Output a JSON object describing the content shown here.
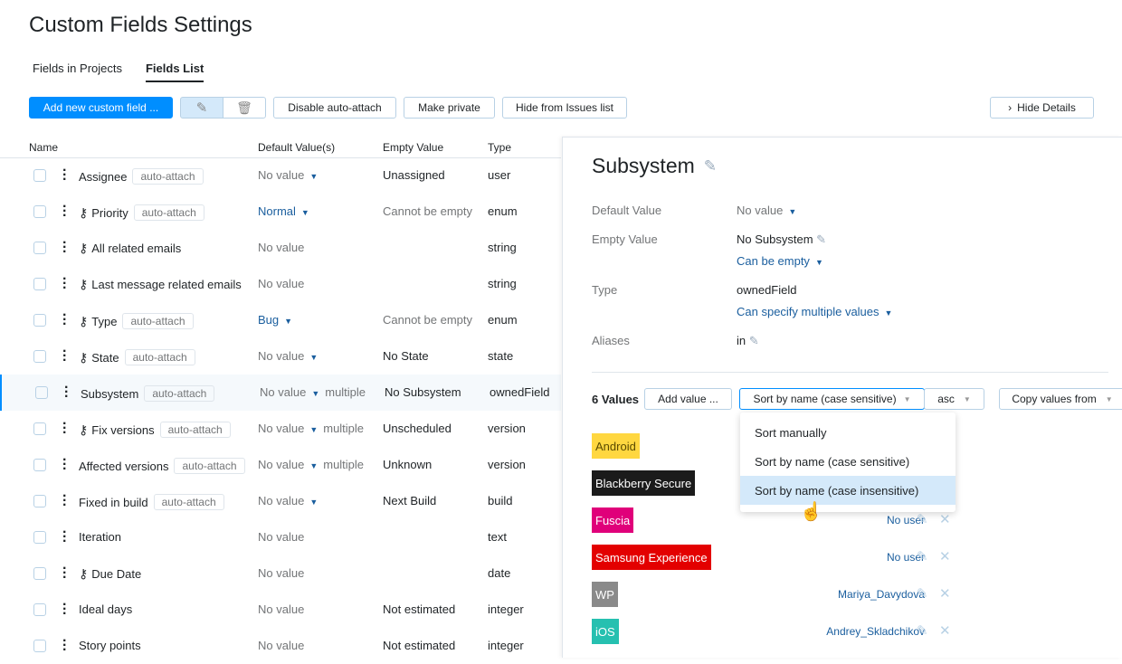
{
  "title": "Custom Fields Settings",
  "tabs": [
    {
      "label": "Fields in Projects"
    },
    {
      "label": "Fields List"
    }
  ],
  "toolbar": {
    "add": "Add new custom field ...",
    "disable": "Disable auto-attach",
    "private": "Make private",
    "hide_issues": "Hide from Issues list",
    "hide_details": "Hide Details"
  },
  "columns": {
    "name": "Name",
    "default": "Default Value(s)",
    "empty": "Empty Value",
    "type": "Type"
  },
  "rows": [
    {
      "name": "Assignee",
      "tag": "auto-attach",
      "key": false,
      "default": "No value",
      "dd": true,
      "multiple": "",
      "empty": "Unassigned",
      "type": "user"
    },
    {
      "name": "Priority",
      "tag": "auto-attach",
      "key": true,
      "default": "Normal",
      "dd": true,
      "link": true,
      "multiple": "",
      "empty": "Cannot be empty",
      "emptyMuted": true,
      "type": "enum"
    },
    {
      "name": "All related emails",
      "tag": "",
      "key": true,
      "default": "No value",
      "dd": false,
      "multiple": "",
      "empty": "",
      "type": "string"
    },
    {
      "name": "Last message related emails",
      "tag": "",
      "key": true,
      "default": "No value",
      "dd": false,
      "multiple": "",
      "empty": "",
      "type": "string"
    },
    {
      "name": "Type",
      "tag": "auto-attach",
      "key": true,
      "default": "Bug",
      "dd": true,
      "link": true,
      "multiple": "",
      "empty": "Cannot be empty",
      "emptyMuted": true,
      "type": "enum"
    },
    {
      "name": "State",
      "tag": "auto-attach",
      "key": true,
      "default": "No value",
      "dd": true,
      "multiple": "",
      "empty": "No State",
      "type": "state"
    },
    {
      "name": "Subsystem",
      "tag": "auto-attach",
      "key": false,
      "default": "No value",
      "dd": true,
      "multiple": "multiple",
      "empty": "No Subsystem",
      "type": "ownedField",
      "selected": true
    },
    {
      "name": "Fix versions",
      "tag": "auto-attach",
      "key": true,
      "default": "No value",
      "dd": true,
      "multiple": "multiple",
      "empty": "Unscheduled",
      "type": "version"
    },
    {
      "name": "Affected versions",
      "tag": "auto-attach",
      "key": false,
      "default": "No value",
      "dd": true,
      "multiple": "multiple",
      "empty": "Unknown",
      "type": "version"
    },
    {
      "name": "Fixed in build",
      "tag": "auto-attach",
      "key": false,
      "default": "No value",
      "dd": true,
      "multiple": "",
      "empty": "Next Build",
      "type": "build"
    },
    {
      "name": "Iteration",
      "tag": "",
      "key": false,
      "default": "No value",
      "dd": false,
      "multiple": "",
      "empty": "",
      "type": "text"
    },
    {
      "name": "Due Date",
      "tag": "",
      "key": true,
      "default": "No value",
      "dd": false,
      "multiple": "",
      "empty": "",
      "type": "date"
    },
    {
      "name": "Ideal days",
      "tag": "",
      "key": false,
      "default": "No value",
      "dd": false,
      "multiple": "",
      "empty": "Not estimated",
      "type": "integer"
    },
    {
      "name": "Story points",
      "tag": "",
      "key": false,
      "default": "No value",
      "dd": false,
      "multiple": "",
      "empty": "Not estimated",
      "type": "integer"
    }
  ],
  "details": {
    "title": "Subsystem",
    "default_label": "Default Value",
    "default_value": "No value",
    "empty_label": "Empty Value",
    "empty_value": "No Subsystem",
    "empty_option": "Can be empty",
    "type_label": "Type",
    "type_value": "ownedField",
    "type_option": "Can specify multiple values",
    "aliases_label": "Aliases",
    "aliases_value": "in",
    "values_count": "6 Values",
    "add_value": "Add value ...",
    "sort": "Sort by name (case sensitive)",
    "order": "asc",
    "copy": "Copy values from",
    "sort_options": [
      "Sort manually",
      "Sort by name (case sensitive)",
      "Sort by name (case insensitive)"
    ],
    "values": [
      {
        "name": "Android",
        "bg": "#ffd740",
        "fg": "#5a4a00",
        "user": ""
      },
      {
        "name": "Blackberry Secure",
        "bg": "#1b1b1b",
        "fg": "#ffffff",
        "user": ""
      },
      {
        "name": "Fuscia",
        "bg": "#e0007a",
        "fg": "#ffffff",
        "user": "No user"
      },
      {
        "name": "Samsung Experience",
        "bg": "#e30000",
        "fg": "#ffffff",
        "user": "No user"
      },
      {
        "name": "WP",
        "bg": "#8a8a8a",
        "fg": "#ffffff",
        "user": "Mariya_Davydova"
      },
      {
        "name": "iOS",
        "bg": "#26c0b0",
        "fg": "#ffffff",
        "user": "Andrey_Skladchikov"
      }
    ]
  }
}
